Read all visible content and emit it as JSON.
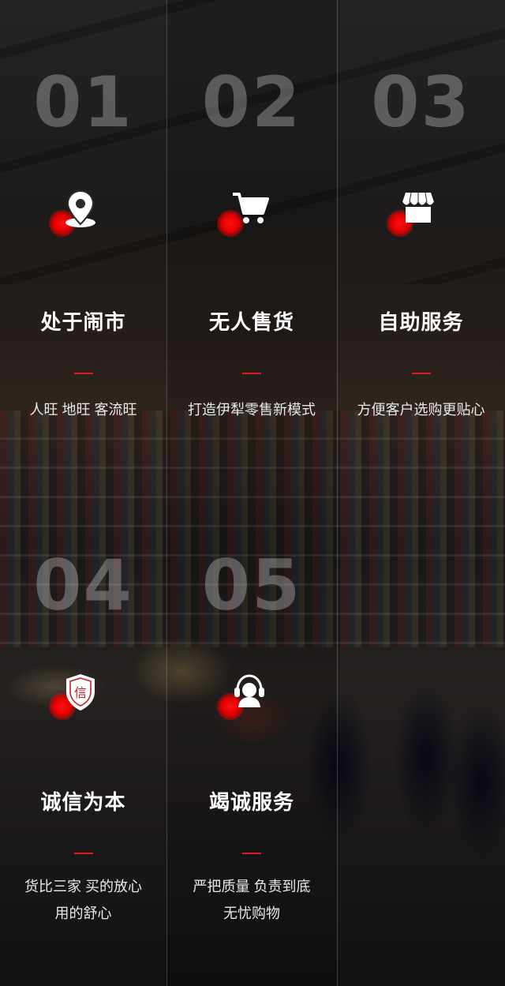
{
  "features": [
    {
      "num": "01",
      "title": "处于闹市",
      "desc": "人旺  地旺  客流旺",
      "icon": "location-pin-icon"
    },
    {
      "num": "02",
      "title": "无人售货",
      "desc": "打造伊犁零售新模式",
      "icon": "shopping-cart-icon"
    },
    {
      "num": "03",
      "title": "自助服务",
      "desc": "方便客户选购更贴心",
      "icon": "storefront-icon"
    },
    {
      "num": "04",
      "title": "诚信为本",
      "desc": "货比三家 买的放心\n用的舒心",
      "icon": "trust-shield-icon",
      "icon_text": "信"
    },
    {
      "num": "05",
      "title": "竭诚服务",
      "desc": "严把质量  负责到底\n无忧购物",
      "icon": "customer-service-icon"
    }
  ],
  "colors": {
    "accent": "#e41a1a",
    "text": "#ffffff"
  }
}
